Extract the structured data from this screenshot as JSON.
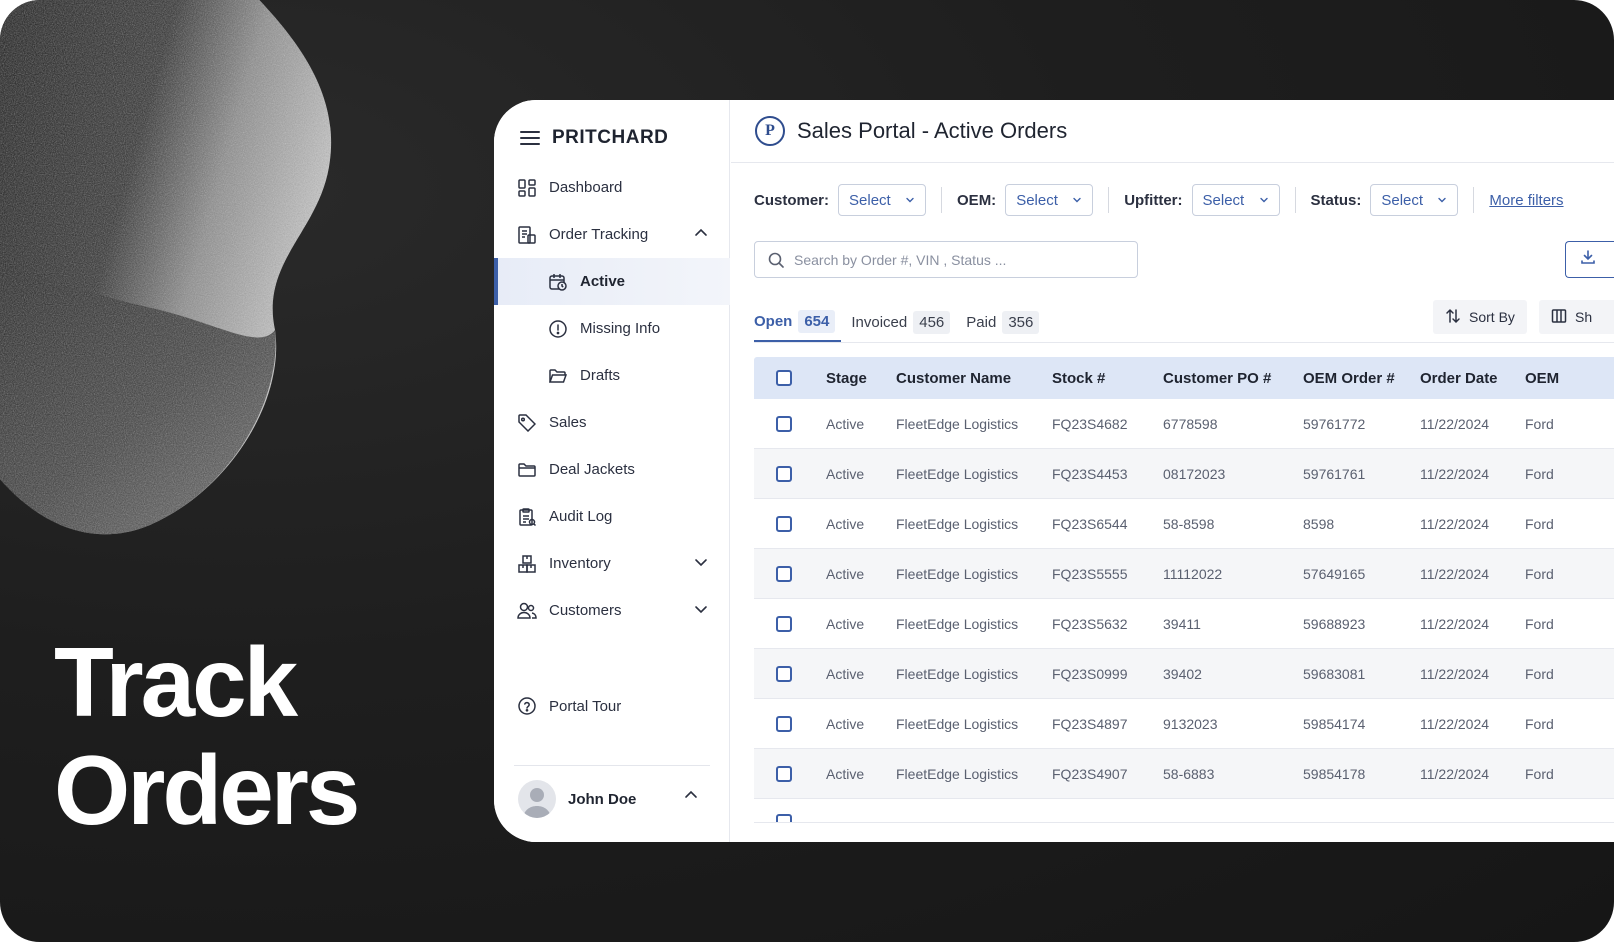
{
  "hero": {
    "line1": "Track",
    "line2": "Orders"
  },
  "sidebar": {
    "brand": "PRITCHARD",
    "items": [
      {
        "label": "Dashboard",
        "icon": "dashboard-icon"
      },
      {
        "label": "Order Tracking",
        "icon": "order-tracking-icon",
        "expanded": true
      },
      {
        "label": "Active",
        "icon": "calendar-clock-icon",
        "sub": true,
        "active": true
      },
      {
        "label": "Missing Info",
        "icon": "alert-circle-icon",
        "sub": true
      },
      {
        "label": "Drafts",
        "icon": "folder-open-icon",
        "sub": true
      },
      {
        "label": "Sales",
        "icon": "tag-icon"
      },
      {
        "label": "Deal Jackets",
        "icon": "folder-icon"
      },
      {
        "label": "Audit Log",
        "icon": "clipboard-icon"
      },
      {
        "label": "Inventory",
        "icon": "boxes-icon",
        "expanded": false
      },
      {
        "label": "Customers",
        "icon": "users-icon",
        "expanded": false
      }
    ],
    "portal_tour": "Portal Tour",
    "user_name": "John Doe"
  },
  "header": {
    "logo_letter": "P",
    "title": "Sales Portal - Active Orders"
  },
  "filters": {
    "customer_label": "Customer:",
    "oem_label": "OEM:",
    "upfitter_label": "Upfitter:",
    "status_label": "Status:",
    "select_value": "Select",
    "more_filters": "More filters"
  },
  "search": {
    "placeholder": "Search by Order #, VIN , Status ..."
  },
  "tabs": [
    {
      "label": "Open",
      "count": "654"
    },
    {
      "label": "Invoiced",
      "count": "456"
    },
    {
      "label": "Paid",
      "count": "356"
    }
  ],
  "toolbar": {
    "sort_by": "Sort By",
    "show_label": "Sh"
  },
  "table": {
    "columns": [
      "Stage",
      "Customer Name",
      "Stock #",
      "Customer PO #",
      "OEM Order #",
      "Order Date",
      "OEM"
    ],
    "rows": [
      [
        "Active",
        "FleetEdge Logistics",
        "FQ23S4682",
        "6778598",
        "59761772",
        "11/22/2024",
        "Ford"
      ],
      [
        "Active",
        "FleetEdge Logistics",
        "FQ23S4453",
        "08172023",
        "59761761",
        "11/22/2024",
        "Ford"
      ],
      [
        "Active",
        "FleetEdge Logistics",
        "FQ23S6544",
        "58-8598",
        "8598",
        "11/22/2024",
        "Ford"
      ],
      [
        "Active",
        "FleetEdge Logistics",
        "FQ23S5555",
        "11112022",
        "57649165",
        "11/22/2024",
        "Ford"
      ],
      [
        "Active",
        "FleetEdge Logistics",
        "FQ23S5632",
        "39411",
        "59688923",
        "11/22/2024",
        "Ford"
      ],
      [
        "Active",
        "FleetEdge Logistics",
        "FQ23S0999",
        "39402",
        "59683081",
        "11/22/2024",
        "Ford"
      ],
      [
        "Active",
        "FleetEdge Logistics",
        "FQ23S4897",
        "9132023",
        "59854174",
        "11/22/2024",
        "Ford"
      ],
      [
        "Active",
        "FleetEdge Logistics",
        "FQ23S4907",
        "58-6883",
        "59854178",
        "11/22/2024",
        "Ford"
      ]
    ]
  },
  "colors": {
    "accent": "#3c5fa8",
    "header_row": "#dde6f6",
    "background": "#1e1e1e"
  }
}
